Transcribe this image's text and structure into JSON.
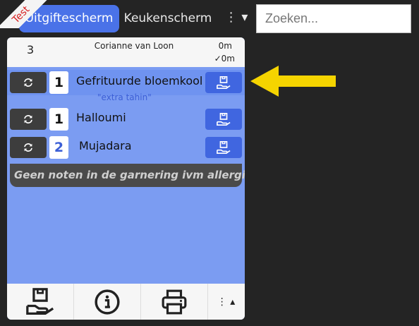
{
  "ribbon": {
    "text": "Test"
  },
  "nav": {
    "tabs": [
      {
        "label": "Uitgiftescherm"
      },
      {
        "label": "Keukenscherm"
      }
    ],
    "more_label": "⋮ ▾"
  },
  "search": {
    "placeholder": "Zoeken...",
    "value": ""
  },
  "order": {
    "number": "3",
    "customer": "Corianne van Loon",
    "elapsed": "0m",
    "confirmed_elapsed": "✓0m",
    "items": [
      {
        "qty": "1",
        "name": "Gefrituurde bloemkool",
        "note": "\"extra tahin\""
      },
      {
        "qty": "1",
        "name": "Halloumi"
      },
      {
        "qty": "2",
        "name": "Mujadara"
      }
    ],
    "order_note": "Geen noten in de garnering ivm allergie"
  },
  "footer": {
    "more_label": "⋮ ▴"
  },
  "colors": {
    "accent": "#4a72e8",
    "card": "#7b9cf2",
    "arrow": "#f5d400"
  }
}
